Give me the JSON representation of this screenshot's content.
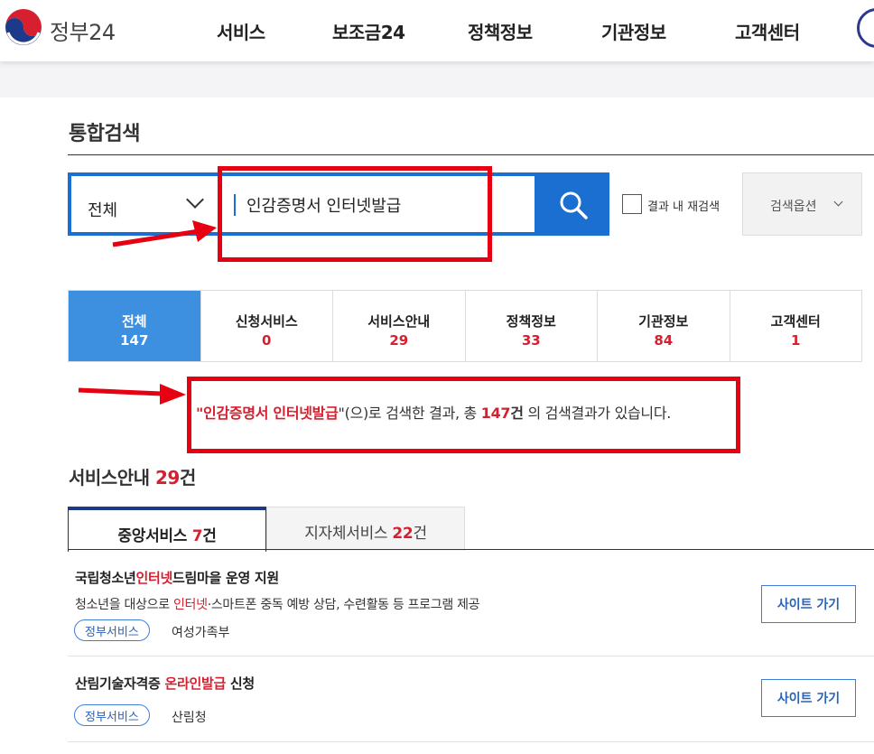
{
  "header": {
    "logo_text": "정부24",
    "nav": [
      "서비스",
      "보조금24",
      "정책정보",
      "기관정보",
      "고객센터"
    ]
  },
  "page_title": "통합검색",
  "search": {
    "scope": "전체",
    "query": "인감증명서 인터넷발급",
    "research_label": "결과 내 재검색",
    "options_label": "검색옵션"
  },
  "tabs": [
    {
      "label": "전체",
      "count": "147"
    },
    {
      "label": "신청서비스",
      "count": "0"
    },
    {
      "label": "서비스안내",
      "count": "29"
    },
    {
      "label": "정책정보",
      "count": "33"
    },
    {
      "label": "기관정보",
      "count": "84"
    },
    {
      "label": "고객센터",
      "count": "1"
    }
  ],
  "result": {
    "open_quote": "\"",
    "keyword": "인감증명서 인터넷발급",
    "close_quote": "\"(으)로 검색한 결과, 총 ",
    "total": "147",
    "unit": "건",
    "suffix": " 의 검색결과가 있습니다."
  },
  "section": {
    "title": "서비스안내",
    "count": "29",
    "unit": "건"
  },
  "subtabs": [
    {
      "label": "중앙서비스 ",
      "count": "7",
      "unit": "건"
    },
    {
      "label": "지자체서비스 ",
      "count": "22",
      "unit": "건"
    }
  ],
  "items": [
    {
      "title_pre": "국립청소년",
      "title_hl": "인터넷",
      "title_post": "드림마을 운영 지원",
      "desc_pre": "청소년을 대상으로 ",
      "desc_hl": "인터넷",
      "desc_post": "·스마트폰 중독 예방 상담, 수련활동 등 프로그램 제공",
      "tag": "정부서비스",
      "org": "여성가족부",
      "button": "사이트 가기"
    },
    {
      "title_pre": "산림기술자격증 ",
      "title_hl": "온라인발급",
      "title_post": " 신청",
      "tag": "정부서비스",
      "org": "산림청",
      "button": "사이트 가기"
    }
  ],
  "colors": {
    "primary": "#1a6fd1",
    "active_tab": "#3d8fe0",
    "highlight": "#d6202f",
    "annotation": "#e60012"
  }
}
